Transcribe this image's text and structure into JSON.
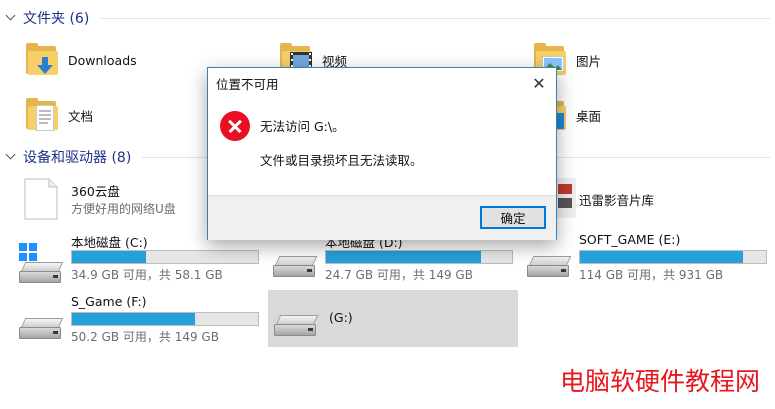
{
  "folders_section": {
    "title": "文件夹 (6)",
    "items": [
      {
        "label": "Downloads",
        "icon": "downloads-folder-icon"
      },
      {
        "label": "视频",
        "icon": "videos-folder-icon"
      },
      {
        "label": "图片",
        "icon": "pictures-folder-icon"
      },
      {
        "label": "文档",
        "icon": "documents-folder-icon"
      },
      {
        "label": "桌面",
        "icon": "desktop-folder-icon"
      }
    ]
  },
  "devices_section": {
    "title": "设备和驱动器 (8)",
    "items": [
      {
        "name": "360云盘",
        "subtitle": "方便好用的网络U盘",
        "icon": "cloud-drive-icon"
      },
      {
        "name": "迅雷影音片库",
        "icon": "media-library-icon"
      },
      {
        "name": "本地磁盘 (C:)",
        "stat": "34.9 GB 可用，共 58.1 GB",
        "used_fraction": 0.4,
        "icon": "windows-drive-icon"
      },
      {
        "name": "本地磁盘 (D:)",
        "stat": "24.7 GB 可用，共 149 GB",
        "used_fraction": 0.834,
        "icon": "hard-drive-icon"
      },
      {
        "name": "SOFT_GAME (E:)",
        "stat": "114 GB 可用，共 931 GB",
        "used_fraction": 0.878,
        "icon": "hard-drive-icon"
      },
      {
        "name": "S_Game (F:)",
        "stat": "50.2 GB 可用，共 149 GB",
        "used_fraction": 0.663,
        "icon": "hard-drive-icon"
      },
      {
        "name": "(G:)",
        "icon": "hard-drive-icon"
      }
    ]
  },
  "dialog": {
    "title": "位置不可用",
    "message_line1": "无法访问 G:\\。",
    "message_line2": "文件或目录损坏且无法读取。",
    "ok_label": "确定",
    "icon": "error-icon"
  },
  "watermark": "电脑软硬件教程网",
  "colors": {
    "progress_fill": "#26a0da",
    "header_text": "#1e3287",
    "error_red": "#e81123",
    "watermark_red": "#e8161d"
  }
}
